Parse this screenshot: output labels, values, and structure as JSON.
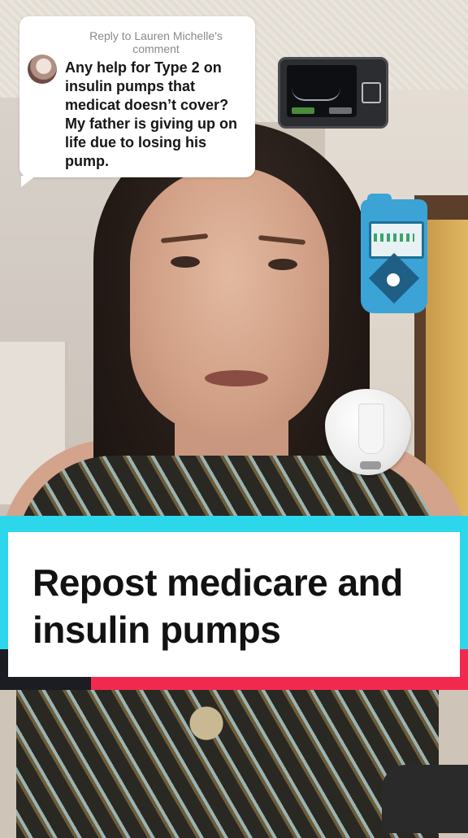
{
  "comment": {
    "reply_to": "Reply to Lauren Michelle's comment",
    "text": "Any help for Type 2 on insulin pumps that medicat doesn’t cover? My father is giving up on life due to losing his pump."
  },
  "caption": {
    "text": "Repost medicare and insulin pumps"
  },
  "stickers": [
    "insulin-pump-device-icon",
    "cgm-receiver-icon",
    "insulin-pod-icon"
  ],
  "colors": {
    "banner_cyan": "#2cd7ec",
    "banner_pink": "#f2294f",
    "banner_dark": "#1c1d22",
    "card": "#ffffff"
  }
}
